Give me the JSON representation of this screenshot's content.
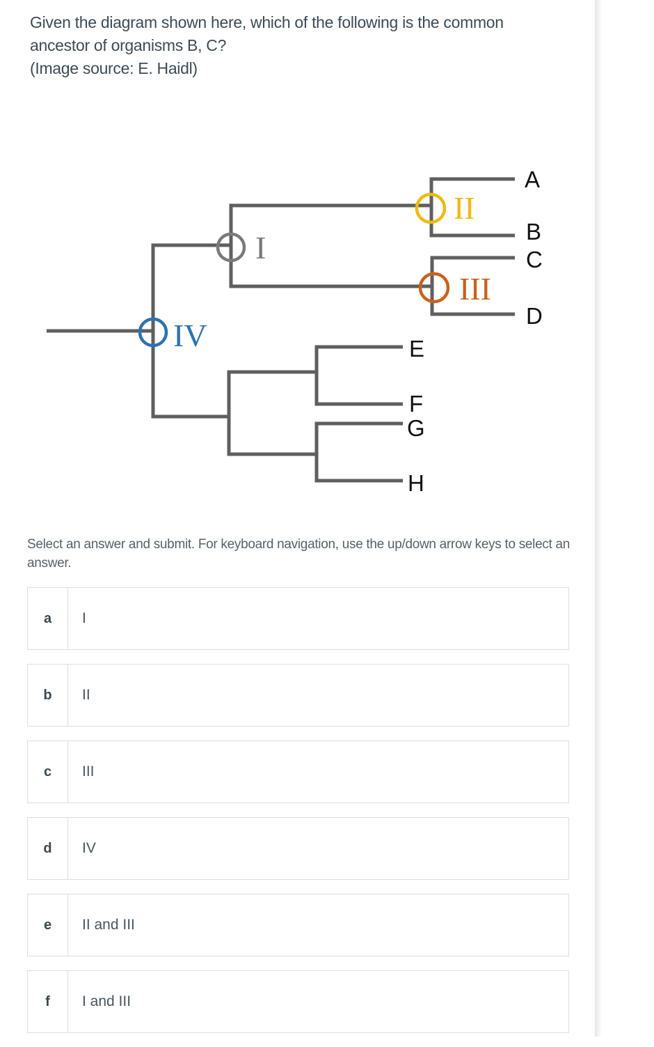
{
  "question": {
    "lines": [
      "Given the diagram shown here, which of the following is the common",
      "ancestor of organisms B, C?",
      "(Image source: E. Haidl)"
    ]
  },
  "diagram": {
    "type": "cladogram",
    "line_color": "#5f5f5f",
    "taxa": [
      "A",
      "B",
      "C",
      "D",
      "E",
      "F",
      "G",
      "H"
    ],
    "nodes": [
      {
        "label": "I",
        "color": "#7a7a7a",
        "descendants": [
          "A",
          "B",
          "C",
          "D"
        ]
      },
      {
        "label": "II",
        "color": "#f0b912",
        "descendants": [
          "A",
          "B"
        ]
      },
      {
        "label": "III",
        "color": "#c8621d",
        "descendants": [
          "C",
          "D"
        ]
      },
      {
        "label": "IV",
        "color": "#2e72b0",
        "descendants": [
          "A",
          "B",
          "C",
          "D",
          "E",
          "F",
          "G",
          "H"
        ]
      }
    ]
  },
  "instructions": "Select an answer and submit. For keyboard navigation, use the up/down arrow keys to select an answer.",
  "answers": [
    {
      "letter": "a",
      "text": "I"
    },
    {
      "letter": "b",
      "text": "II"
    },
    {
      "letter": "c",
      "text": "III"
    },
    {
      "letter": "d",
      "text": "IV"
    },
    {
      "letter": "e",
      "text": "II and III"
    },
    {
      "letter": "f",
      "text": "I and III"
    }
  ]
}
